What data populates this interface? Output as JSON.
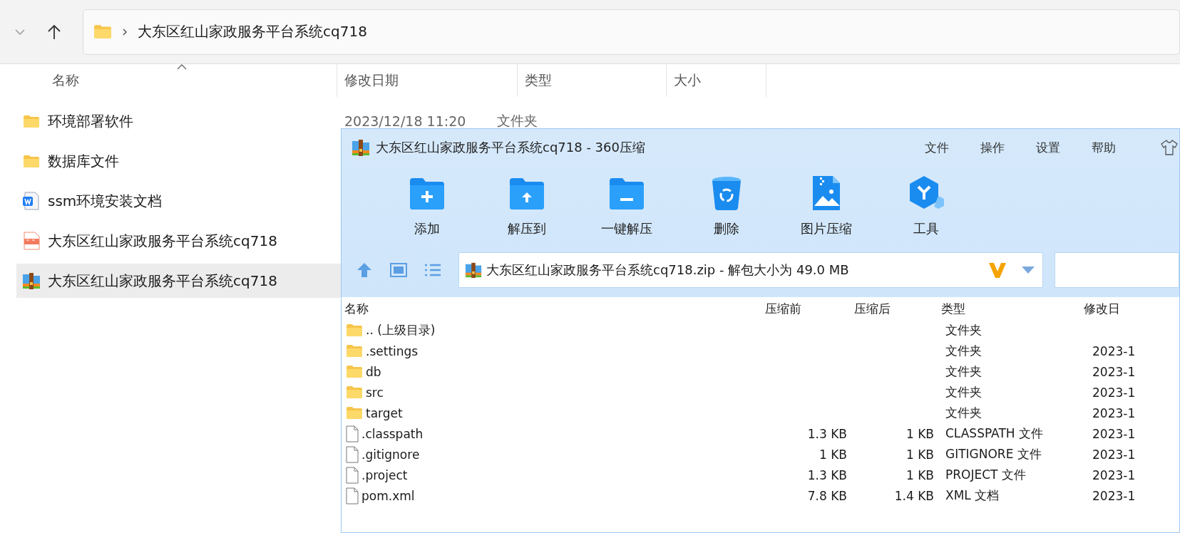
{
  "explorer": {
    "address": {
      "crumb": "大东区红山家政服务平台系统cq718"
    },
    "columns": [
      "名称",
      "修改日期",
      "类型",
      "大小"
    ],
    "items": [
      {
        "name": "环境部署软件",
        "kind": "folder",
        "modified": "2023/12/18 11:20",
        "type": "文件夹",
        "selected": false
      },
      {
        "name": "数据库文件",
        "kind": "folder",
        "selected": false
      },
      {
        "name": "ssm环境安装文档",
        "kind": "word",
        "selected": false
      },
      {
        "name": "大东区红山家政服务平台系统cq718",
        "kind": "video",
        "selected": false
      },
      {
        "name": "大东区红山家政服务平台系统cq718",
        "kind": "archive",
        "selected": true
      }
    ]
  },
  "archive_window": {
    "title": "大东区红山家政服务平台系统cq718 - 360压缩",
    "menu": [
      "文件",
      "操作",
      "设置",
      "帮助"
    ],
    "toolbar": [
      {
        "label": "添加",
        "kind": "add"
      },
      {
        "label": "解压到",
        "kind": "extract"
      },
      {
        "label": "一键解压",
        "kind": "quick"
      },
      {
        "label": "删除",
        "kind": "delete"
      },
      {
        "label": "图片压缩",
        "kind": "image"
      },
      {
        "label": "工具",
        "kind": "tools"
      }
    ],
    "path": "大东区红山家政服务平台系统cq718.zip - 解包大小为 49.0 MB",
    "columns": [
      "名称",
      "压缩前",
      "压缩后",
      "类型",
      "修改日"
    ],
    "rows": [
      {
        "name": ".. (上级目录)",
        "kind": "folder",
        "type": "文件夹"
      },
      {
        "name": ".settings",
        "kind": "folder",
        "type": "文件夹",
        "modified": "2023-1"
      },
      {
        "name": "db",
        "kind": "folder",
        "type": "文件夹",
        "modified": "2023-1"
      },
      {
        "name": "src",
        "kind": "folder",
        "type": "文件夹",
        "modified": "2023-1"
      },
      {
        "name": "target",
        "kind": "folder",
        "type": "文件夹",
        "modified": "2023-1"
      },
      {
        "name": ".classpath",
        "kind": "file",
        "original": "1.3 KB",
        "packed": "1 KB",
        "type": "CLASSPATH 文件",
        "modified": "2023-1"
      },
      {
        "name": ".gitignore",
        "kind": "file",
        "original": "1 KB",
        "packed": "1 KB",
        "type": "GITIGNORE 文件",
        "modified": "2023-1"
      },
      {
        "name": ".project",
        "kind": "file",
        "original": "1.3 KB",
        "packed": "1 KB",
        "type": "PROJECT 文件",
        "modified": "2023-1"
      },
      {
        "name": "pom.xml",
        "kind": "file",
        "original": "7.8 KB",
        "packed": "1.4 KB",
        "type": "XML 文档",
        "modified": "2023-1"
      }
    ]
  }
}
